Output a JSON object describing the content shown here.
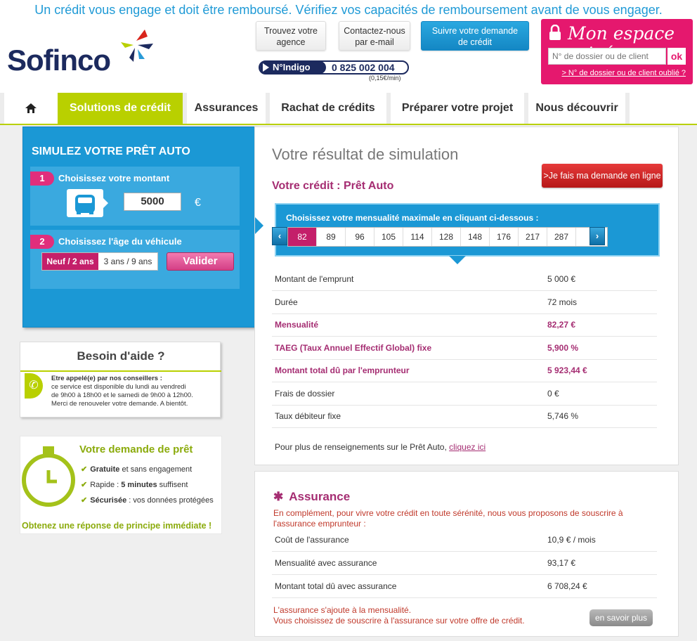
{
  "banner": "Un crédit vous engage et doit être remboursé. Vérifiez vos capacités de remboursement avant de vous engager.",
  "brand": {
    "logo": "Sofinco",
    "primary": "#1c2a5e",
    "accent_pink": "#e5186e",
    "accent_green": "#b9d000",
    "accent_blue": "#1b98d5"
  },
  "header": {
    "agence_1": "Trouvez votre",
    "agence_2": "agence",
    "contact_1": "Contactez-nous",
    "contact_2": "par e-mail",
    "suivre_1": "Suivre votre demande",
    "suivre_2": "de crédit",
    "indigo_tag": "N°Indigo",
    "indigo_number": "0 825 002 004",
    "indigo_price": "(0,15€/min)"
  },
  "espace": {
    "title": "Mon espace privé",
    "placeholder": "N° de dossier ou de client",
    "ok": "ok",
    "forgot": "> N° de dossier ou de client oublié ?"
  },
  "nav": {
    "items": [
      "Solutions de crédit",
      "Assurances",
      "Rachat de crédits",
      "Préparer votre projet",
      "Nous découvrir"
    ]
  },
  "sim": {
    "title": "SIMULEZ VOTRE PRÊT AUTO",
    "step1_num": "1",
    "step1_label": "Choisissez votre montant",
    "amount": "5000",
    "currency": "€",
    "step2_num": "2",
    "step2_label": "Choisissez l'âge du véhicule",
    "opt_new": "Neuf / 2 ans",
    "opt_old": "3 ans / 9 ans",
    "validate": "Valider"
  },
  "help": {
    "title": "Besoin d'aide ?",
    "line1": "Etre appelé(e) par nos conseillers :",
    "line2": "ce service est disponible du lundi au vendredi",
    "line3": "de 9h00 à 18h00 et le samedi de 9h00 à 12h00.",
    "line4": "Merci de renouveler votre demande. A bientôt."
  },
  "demande": {
    "title": "Votre demande de prêt",
    "item1_b": "Gratuite",
    "item1": " et sans engagement",
    "item2": "Rapide : ",
    "item2_b": "5 minutes",
    "item2_end": " suffisent",
    "item3_b": "Sécurisée",
    "item3": " : vos données protégées",
    "footer": "Obtenez une réponse de principe immédiate !"
  },
  "result": {
    "title": "Votre résultat de simulation",
    "subtitle": "Votre crédit : Prêt Auto",
    "apply": ">Je fais ma demande en ligne",
    "mens_label": "Choisissez votre mensualité maximale en cliquant ci-dessous :",
    "options": [
      "82",
      "89",
      "96",
      "105",
      "114",
      "128",
      "148",
      "176",
      "217",
      "287"
    ],
    "selected_index": 0,
    "rows": [
      {
        "label": "Montant de l'emprunt",
        "value": "5 000 €",
        "highlight": false
      },
      {
        "label": "Durée",
        "value": "72 mois",
        "highlight": false
      },
      {
        "label": "Mensualité",
        "value": "82,27 €",
        "highlight": true
      },
      {
        "label": "TAEG (Taux Annuel Effectif Global) fixe",
        "value": "5,900 %",
        "highlight": true
      },
      {
        "label": "Montant total dû par l'emprunteur",
        "value": "5 923,44 €",
        "highlight": true
      },
      {
        "label": "Frais de dossier",
        "value": "0 €",
        "highlight": false
      },
      {
        "label": "Taux débiteur fixe",
        "value": "5,746 %",
        "highlight": false
      }
    ],
    "more_text": "Pour plus de renseignements sur le Prêt Auto, ",
    "more_link": "cliquez ici"
  },
  "assurance": {
    "title": "Assurance",
    "intro": "En complément, pour vivre votre crédit en toute sérénité, nous vous proposons de souscrire à l'assurance emprunteur :",
    "rows": [
      {
        "label": "Coût de l'assurance",
        "value": "10,9 € / mois"
      },
      {
        "label": "Mensualité avec assurance",
        "value": "93,17 €"
      },
      {
        "label": "Montant total dû avec assurance",
        "value": "6 708,24 €"
      }
    ],
    "foot1": "L'assurance s'ajoute à la mensualité.",
    "foot2": "Vous choisissez de souscrire à l'assurance sur votre offre de crédit.",
    "more": "en savoir plus"
  }
}
